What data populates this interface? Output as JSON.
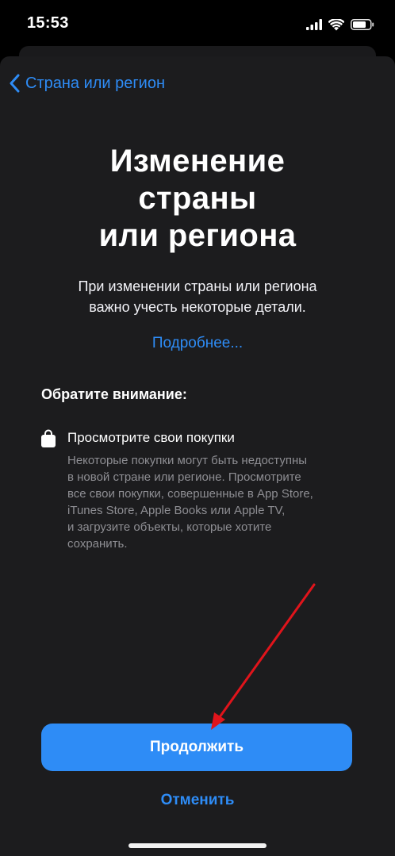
{
  "status_bar": {
    "time": "15:53",
    "icons": [
      "signal-icon",
      "wifi-icon",
      "battery-icon"
    ]
  },
  "nav": {
    "back_label": "Страна или регион",
    "back_icon": "chevron-left-icon"
  },
  "title_lines": [
    "Изменение",
    "страны",
    "или региона"
  ],
  "subtitle_lines": [
    "При изменении страны или региона",
    "важно учесть некоторые детали."
  ],
  "more_link": "Подробнее...",
  "notice_heading": "Обратите внимание:",
  "item": {
    "icon": "shopping-bag-icon",
    "title": "Просмотрите свои покупки",
    "description_lines": [
      "Некоторые покупки могут быть недоступны",
      "в новой стране или регионе. Просмотрите",
      "все свои покупки, совершенные в App Store,",
      "iTunes Store, Apple Books или Apple TV,",
      "и загрузите объекты, которые хотите",
      "сохранить."
    ]
  },
  "buttons": {
    "continue_label": "Продолжить",
    "cancel_label": "Отменить"
  },
  "colors": {
    "accent": "#2e8cf6",
    "sheet_background": "#1c1c1e",
    "annotation_arrow": "#e0141b"
  }
}
